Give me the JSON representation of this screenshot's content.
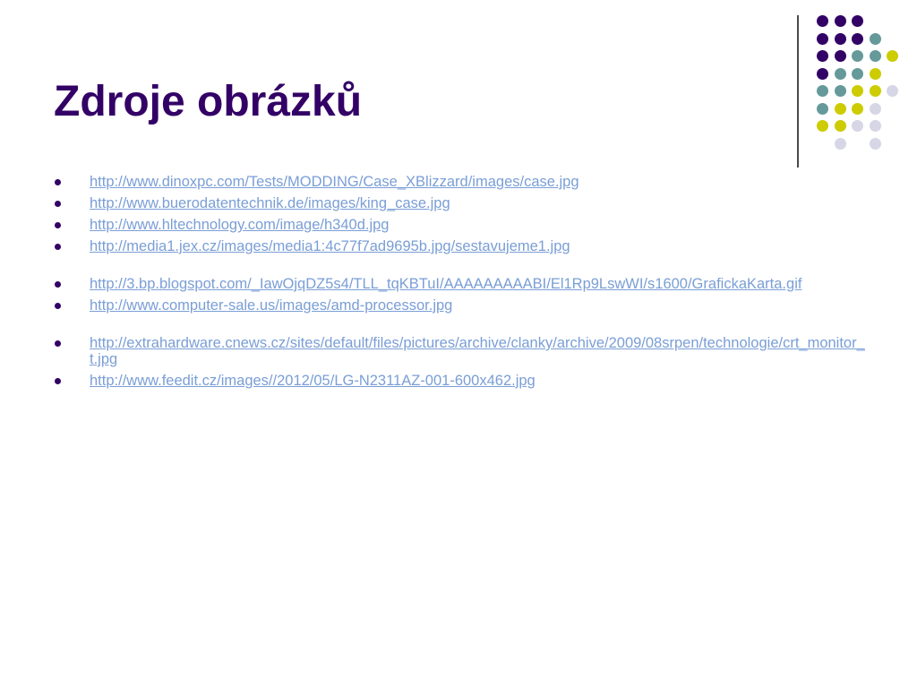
{
  "slide": {
    "title": "Zdroje obrázků",
    "links": [
      "http://www.dinoxpc.com/Tests/MODDING/Case_XBlizzard/images/case.jpg",
      "http://www.buerodatentechnik.de/images/king_case.jpg",
      "http://www.hltechnology.com/image/h340d.jpg",
      "http://media1.jex.cz/images/media1:4c77f7ad9695b.jpg/sestavujeme1.jpg",
      "http://3.bp.blogspot.com/_IawOjqDZ5s4/TLL_tqKBTuI/AAAAAAAAABI/El1Rp9LswWI/s1600/GrafickaKarta.gif",
      "http://www.computer-sale.us/images/amd-processor.jpg",
      "http://extrahardware.cnews.cz/sites/default/files/pictures/archive/clanky/archive/2009/08srpen/technologie/crt_monitor_t.jpg",
      "http://www.feedit.cz/images//2012/05/LG-N2311AZ-001-600x462.jpg"
    ]
  },
  "colors": {
    "title": "#330066",
    "bullet": "#330066",
    "link": "#7a9ed6",
    "dot_purple": "#330066",
    "dot_teal": "#669999",
    "dot_yellow": "#cccc00",
    "dot_lavender": "#d6d6e6"
  },
  "decoration": {
    "dot_grid": [
      [
        "purple",
        "purple",
        "purple",
        "none"
      ],
      [
        "purple",
        "purple",
        "purple",
        "teal"
      ],
      [
        "purple",
        "purple",
        "teal",
        "teal",
        "yellow"
      ],
      [
        "purple",
        "teal",
        "teal",
        "yellow"
      ],
      [
        "teal",
        "teal",
        "yellow",
        "yellow",
        "lavender"
      ],
      [
        "teal",
        "yellow",
        "yellow",
        "lavender"
      ],
      [
        "yellow",
        "yellow",
        "lavender",
        "lavender"
      ],
      [
        "none",
        "lavender",
        "none",
        "lavender"
      ]
    ]
  }
}
